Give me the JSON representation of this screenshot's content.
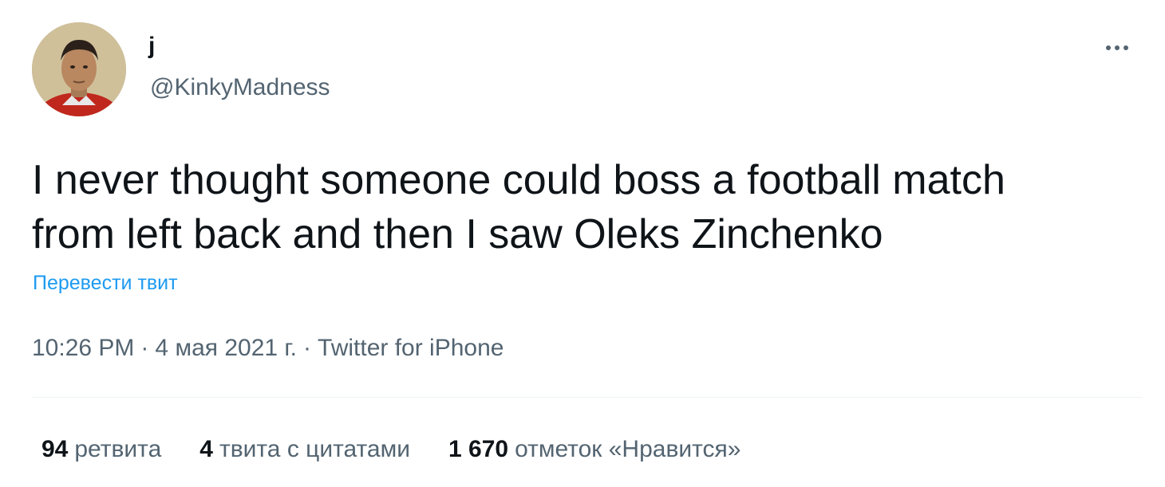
{
  "author": {
    "display_name": "j",
    "handle": "@KinkyMadness"
  },
  "tweet": {
    "text": "I never thought someone could boss a football match\nfrom left back and then I saw Oleks Zinchenko",
    "translate_label": "Перевести твит"
  },
  "meta": {
    "time": "10:26 PM",
    "separator": "·",
    "date": "4 мая 2021 г.",
    "source": "Twitter for iPhone"
  },
  "stats": [
    {
      "count": "94",
      "label": "ретвита"
    },
    {
      "count": "4",
      "label": "твита с цитатами"
    },
    {
      "count": "1 670",
      "label": "отметок «Нравится»"
    }
  ],
  "icons": {
    "avatar": "profile-photo",
    "more": "more-horizontal-icon"
  },
  "colors": {
    "text_primary": "#0f1419",
    "text_secondary": "#536471",
    "link": "#1d9bf0"
  }
}
